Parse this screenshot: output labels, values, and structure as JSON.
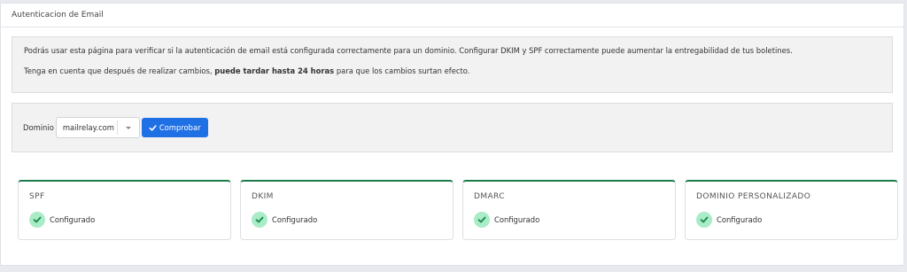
{
  "panel": {
    "title": "Autenticacion de Email"
  },
  "info": {
    "line1": "Podrás usar esta página para verificar si la autenticación de email está configurada correctamente para un dominio. Configurar DKIM y SPF correctamente puede aumentar la entregabilidad de tus boletines.",
    "line2_prefix": "Tenga en cuenta que después de realizar cambios, ",
    "line2_bold": "puede tardar hasta 24 horas",
    "line2_suffix": " para que los cambios surtan efecto."
  },
  "form": {
    "domain_label": "Dominio",
    "domain_value": "mailrelay.com",
    "check_button": "Comprobar",
    "button_icon": "check-icon"
  },
  "cards": [
    {
      "title": "SPF",
      "status": "Configurado",
      "icon": "check-circle-icon"
    },
    {
      "title": "DKIM",
      "status": "Configurado",
      "icon": "check-circle-icon"
    },
    {
      "title": "DMARC",
      "status": "Configurado",
      "icon": "check-circle-icon"
    },
    {
      "title": "DOMINIO PERSONALIZADO",
      "status": "Configurado",
      "icon": "check-circle-icon"
    }
  ],
  "colors": {
    "accent": "#1f6fe5",
    "card_top_border": "#1d7a4a",
    "success_badge": "#a9ecc7",
    "success_check": "#1a8a4a"
  }
}
